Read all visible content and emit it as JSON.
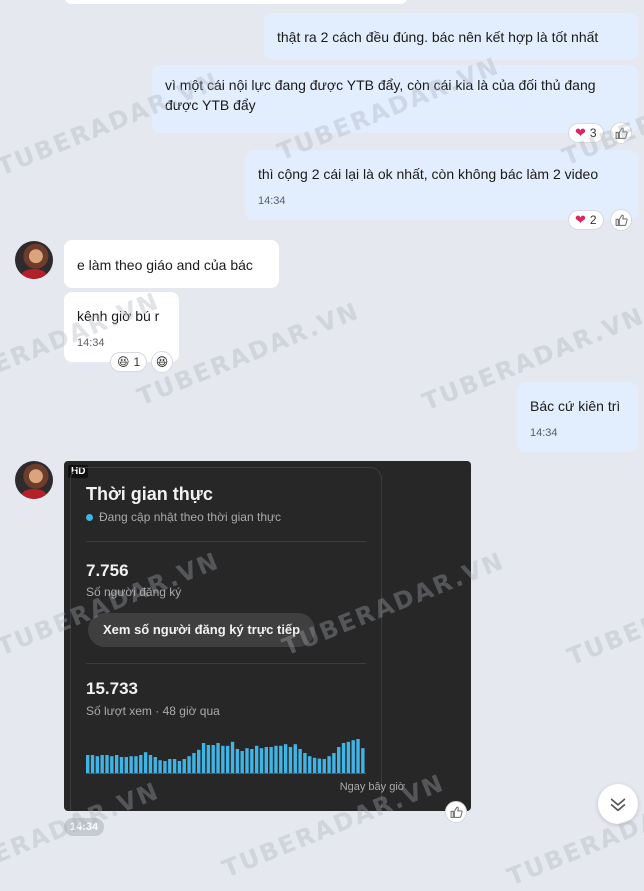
{
  "messages": {
    "m1": {
      "text": "thật ra 2 cách đều đúng. bác nên kết hợp là tốt nhất"
    },
    "m2": {
      "text": "vì một cái nội lực đang được YTB đẩy, còn cái kia là của đối thủ đang được YTB đẩy",
      "reaction_count": "3"
    },
    "m3": {
      "text": "thì cộng 2 cái lại là ok nhất, còn không bác làm 2 video",
      "time": "14:34",
      "reaction_count": "2"
    },
    "m4": {
      "text": "e làm theo giáo and của bác"
    },
    "m5": {
      "text": "kênh giờ bú r",
      "time": "14:34",
      "reaction_count": "1"
    },
    "m6": {
      "text": "Bác cứ kiên trì",
      "time": "14:34"
    }
  },
  "image_card": {
    "badge": "HD",
    "title": "Thời gian thực",
    "subtitle": "Đang cập nhật theo thời gian thực",
    "subscribers": "7.756",
    "subscribers_label": "Số người đăng ký",
    "live_button": "Xem số người đăng ký trực tiếp",
    "views": "15.733",
    "views_label": "Số lượt xem · 48 giờ qua",
    "now_label": "Ngay bây giờ",
    "bar_color": "#41b4e6",
    "bars": [
      0.45,
      0.45,
      0.42,
      0.45,
      0.45,
      0.42,
      0.45,
      0.4,
      0.4,
      0.42,
      0.42,
      0.45,
      0.52,
      0.45,
      0.4,
      0.32,
      0.3,
      0.35,
      0.35,
      0.3,
      0.35,
      0.42,
      0.5,
      0.58,
      0.75,
      0.7,
      0.7,
      0.75,
      0.68,
      0.68,
      0.78,
      0.6,
      0.55,
      0.62,
      0.6,
      0.68,
      0.62,
      0.65,
      0.65,
      0.68,
      0.68,
      0.72,
      0.65,
      0.72,
      0.6,
      0.5,
      0.42,
      0.38,
      0.36,
      0.35,
      0.42,
      0.5,
      0.65,
      0.75,
      0.78,
      0.82,
      0.85,
      0.62
    ]
  },
  "footer_time": "14:34",
  "watermark": "TUBERADAR.VN"
}
